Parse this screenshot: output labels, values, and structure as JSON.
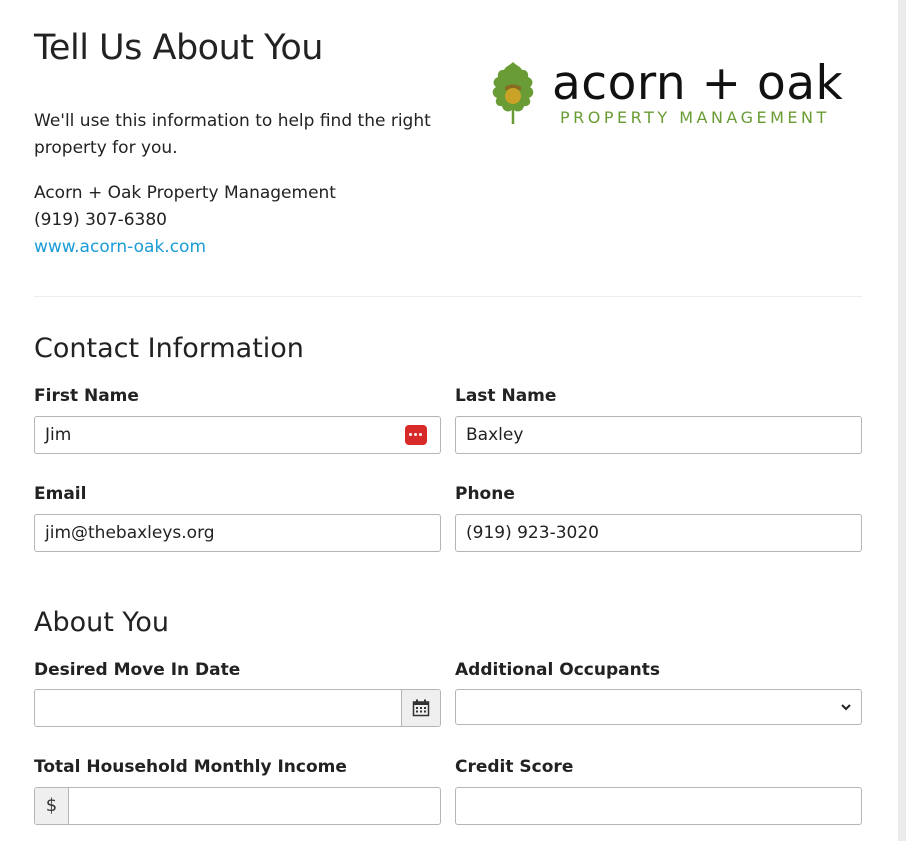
{
  "header": {
    "title": "Tell Us About You",
    "intro": "We'll use this information to help find the right property for you.",
    "company_name": "Acorn + Oak Property Management",
    "company_phone": "(919) 307-6380",
    "company_website": "www.acorn-oak.com"
  },
  "logo": {
    "wordmark": "acorn + oak",
    "tagline": "PROPERTY MANAGEMENT",
    "leaf_color": "#6a9c35",
    "acorn_color": "#c9a227"
  },
  "contact": {
    "section_title": "Contact Information",
    "first_name_label": "First Name",
    "first_name_value": "Jim",
    "last_name_label": "Last Name",
    "last_name_value": "Baxley",
    "email_label": "Email",
    "email_value": "jim@thebaxleys.org",
    "phone_label": "Phone",
    "phone_value": "(919) 923-3020"
  },
  "about": {
    "section_title": "About You",
    "move_in_label": "Desired Move In Date",
    "move_in_value": "",
    "occupants_label": "Additional Occupants",
    "occupants_value": "",
    "income_label": "Total Household Monthly Income",
    "income_prefix": "$",
    "income_value": "",
    "credit_label": "Credit Score",
    "credit_value": ""
  },
  "colors": {
    "link": "#1a9bd7",
    "password_manager_icon": "#d92a2a",
    "border": "#b5b5b5"
  },
  "icons": {
    "password_manager": "password-manager-icon",
    "calendar": "calendar-icon",
    "chevron": "chevron-down-icon"
  }
}
